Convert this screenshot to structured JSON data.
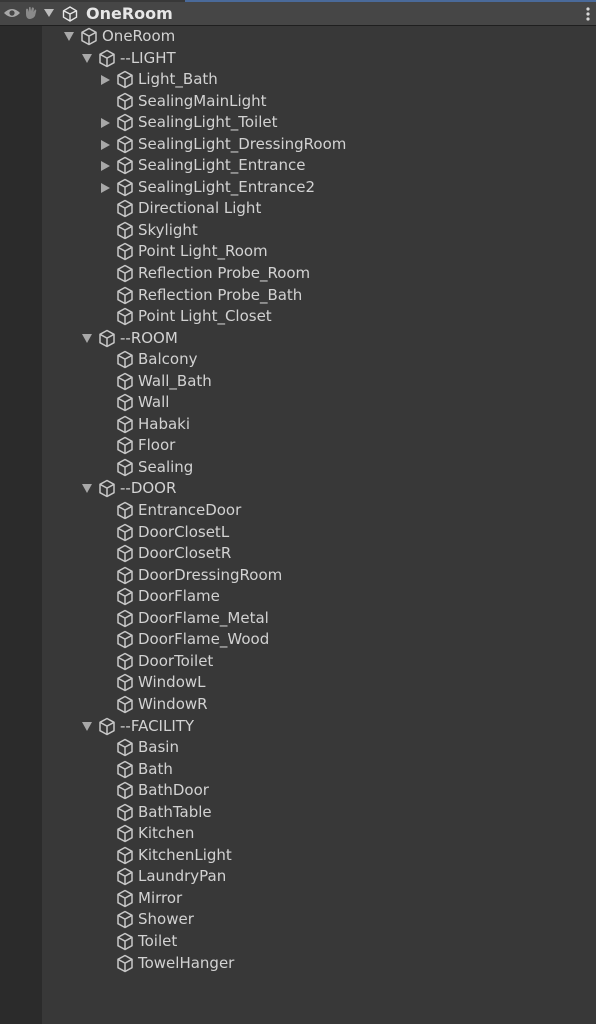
{
  "hierarchy": {
    "scene_title": "OneRoom",
    "icons": {
      "visibility": "eye-icon",
      "pickability": "hand-icon",
      "scene": "unity-scene-icon",
      "object": "cube-icon",
      "menu": "kebab-menu-icon"
    },
    "colors": {
      "background": "#383838",
      "gutter": "#2b2b2b",
      "header": "#464646",
      "text": "#d2d2d2",
      "icon": "#c8c8c8"
    },
    "items": [
      {
        "label": "OneRoom",
        "depth": 0,
        "arrow": "expanded"
      },
      {
        "label": "--LIGHT",
        "depth": 1,
        "arrow": "expanded"
      },
      {
        "label": "Light_Bath",
        "depth": 2,
        "arrow": "collapsed"
      },
      {
        "label": "SealingMainLight",
        "depth": 2,
        "arrow": "none"
      },
      {
        "label": "SealingLight_Toilet",
        "depth": 2,
        "arrow": "collapsed"
      },
      {
        "label": "SealingLight_DressingRoom",
        "depth": 2,
        "arrow": "collapsed"
      },
      {
        "label": "SealingLight_Entrance",
        "depth": 2,
        "arrow": "collapsed"
      },
      {
        "label": "SealingLight_Entrance2",
        "depth": 2,
        "arrow": "collapsed"
      },
      {
        "label": "Directional Light",
        "depth": 2,
        "arrow": "none"
      },
      {
        "label": "Skylight",
        "depth": 2,
        "arrow": "none"
      },
      {
        "label": "Point Light_Room",
        "depth": 2,
        "arrow": "none"
      },
      {
        "label": "Reflection Probe_Room",
        "depth": 2,
        "arrow": "none"
      },
      {
        "label": "Reflection Probe_Bath",
        "depth": 2,
        "arrow": "none"
      },
      {
        "label": "Point Light_Closet",
        "depth": 2,
        "arrow": "none"
      },
      {
        "label": "--ROOM",
        "depth": 1,
        "arrow": "expanded"
      },
      {
        "label": "Balcony",
        "depth": 2,
        "arrow": "none"
      },
      {
        "label": "Wall_Bath",
        "depth": 2,
        "arrow": "none"
      },
      {
        "label": "Wall",
        "depth": 2,
        "arrow": "none"
      },
      {
        "label": "Habaki",
        "depth": 2,
        "arrow": "none"
      },
      {
        "label": "Floor",
        "depth": 2,
        "arrow": "none"
      },
      {
        "label": "Sealing",
        "depth": 2,
        "arrow": "none"
      },
      {
        "label": "--DOOR",
        "depth": 1,
        "arrow": "expanded"
      },
      {
        "label": "EntranceDoor",
        "depth": 2,
        "arrow": "none"
      },
      {
        "label": "DoorClosetL",
        "depth": 2,
        "arrow": "none"
      },
      {
        "label": "DoorClosetR",
        "depth": 2,
        "arrow": "none"
      },
      {
        "label": "DoorDressingRoom",
        "depth": 2,
        "arrow": "none"
      },
      {
        "label": "DoorFlame",
        "depth": 2,
        "arrow": "none"
      },
      {
        "label": "DoorFlame_Metal",
        "depth": 2,
        "arrow": "none"
      },
      {
        "label": "DoorFlame_Wood",
        "depth": 2,
        "arrow": "none"
      },
      {
        "label": "DoorToilet",
        "depth": 2,
        "arrow": "none"
      },
      {
        "label": "WindowL",
        "depth": 2,
        "arrow": "none"
      },
      {
        "label": "WindowR",
        "depth": 2,
        "arrow": "none"
      },
      {
        "label": "--FACILITY",
        "depth": 1,
        "arrow": "expanded"
      },
      {
        "label": "Basin",
        "depth": 2,
        "arrow": "none"
      },
      {
        "label": "Bath",
        "depth": 2,
        "arrow": "none"
      },
      {
        "label": "BathDoor",
        "depth": 2,
        "arrow": "none"
      },
      {
        "label": "BathTable",
        "depth": 2,
        "arrow": "none"
      },
      {
        "label": "Kitchen",
        "depth": 2,
        "arrow": "none"
      },
      {
        "label": "KitchenLight",
        "depth": 2,
        "arrow": "none"
      },
      {
        "label": "LaundryPan",
        "depth": 2,
        "arrow": "none"
      },
      {
        "label": "Mirror",
        "depth": 2,
        "arrow": "none"
      },
      {
        "label": "Shower",
        "depth": 2,
        "arrow": "none"
      },
      {
        "label": "Toilet",
        "depth": 2,
        "arrow": "none"
      },
      {
        "label": "TowelHanger",
        "depth": 2,
        "arrow": "none"
      }
    ]
  }
}
